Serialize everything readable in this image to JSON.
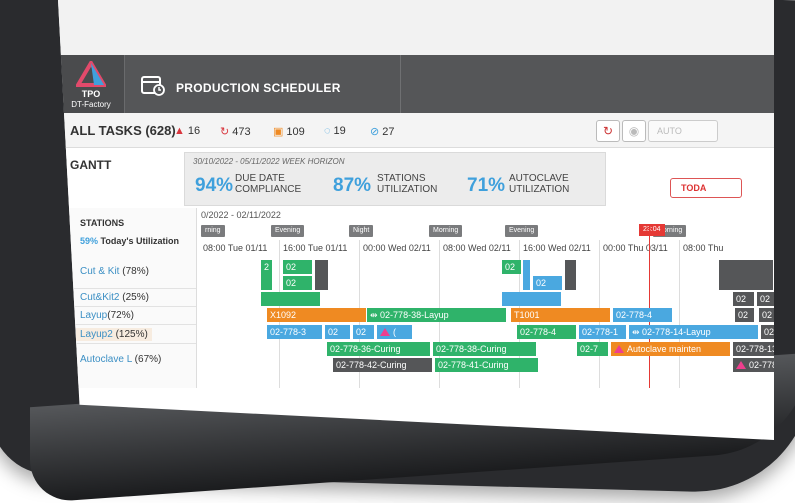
{
  "header": {
    "logo_name": "TPO",
    "logo_sub": "DT-Factory",
    "title": "PRODUCTION SCHEDULER"
  },
  "tasks": {
    "title": "ALL TASKS (628)",
    "badges": [
      {
        "icon": "alert-icon",
        "value": "16",
        "color": "#d9363e"
      },
      {
        "icon": "refresh-icon",
        "value": "473",
        "color": "#d9363e"
      },
      {
        "icon": "calendar-icon",
        "value": "109",
        "color": "#ef8a22"
      },
      {
        "icon": "pending-icon",
        "value": "19",
        "color": "#3fa0dc"
      },
      {
        "icon": "check-icon",
        "value": "27",
        "color": "#3fa0dc"
      }
    ],
    "auto_label": "AUTO"
  },
  "gantt": {
    "label": "GANTT",
    "horizon": "30/10/2022 - 05/11/2022 WEEK HORIZON",
    "kpis": [
      {
        "value": "94%",
        "line1": "DUE DATE",
        "line2": "COMPLIANCE"
      },
      {
        "value": "87%",
        "line1": "STATIONS",
        "line2": "UTILIZATION"
      },
      {
        "value": "71%",
        "line1": "AUTOCLAVE",
        "line2": "UTILIZATION"
      }
    ],
    "today_label": "TODA"
  },
  "stations": {
    "heading": "STATIONS",
    "util_pct": "59%",
    "util_label": "Today's Utilization",
    "rows": [
      {
        "name": "Cut & Kit",
        "pct": "(78%)"
      },
      {
        "name": "Cut&Kit2",
        "pct": "(25%)"
      },
      {
        "name": "Layup",
        "pct": "(72%)"
      },
      {
        "name": "Layup2",
        "pct": "(125%)"
      },
      {
        "name": "Autoclave L",
        "pct": "(67%)"
      }
    ]
  },
  "timeline": {
    "range": "0/2022 - 02/11/2022",
    "now": "23:04",
    "shifts": [
      "rning",
      "Evening",
      "Night",
      "Morning",
      "Evening",
      "Morning"
    ],
    "ticks": [
      "08:00 Tue 01/11",
      "16:00 Tue 01/11",
      "00:00 Wed 02/11",
      "08:00 Wed 02/11",
      "16:00 Wed 02/11",
      "00:00 Thu 03/11",
      "08:00 Thu"
    ],
    "bars": {
      "ck1": [
        "2",
        "02",
        "02",
        "02",
        "02",
        "02"
      ],
      "ck2": [
        "2",
        "02",
        "02",
        "02",
        "02"
      ],
      "layup": [
        "X1092",
        "02-778-38-Layup",
        "T1001",
        "02-778-4",
        "02",
        "02"
      ],
      "layup2": [
        "02-778-3",
        "02",
        "02",
        "(",
        "02-778-4",
        "02-778-1",
        "02-778-14-Layup",
        "02-"
      ],
      "auto1": [
        "02-778-36-Curing",
        "02-778-38-Curing",
        "02-7",
        "Autoclave mainten",
        "02-778-13-C"
      ],
      "auto2": [
        "02-778-42-Curing",
        "02-778-41-Curing",
        "02-778-1"
      ]
    }
  }
}
